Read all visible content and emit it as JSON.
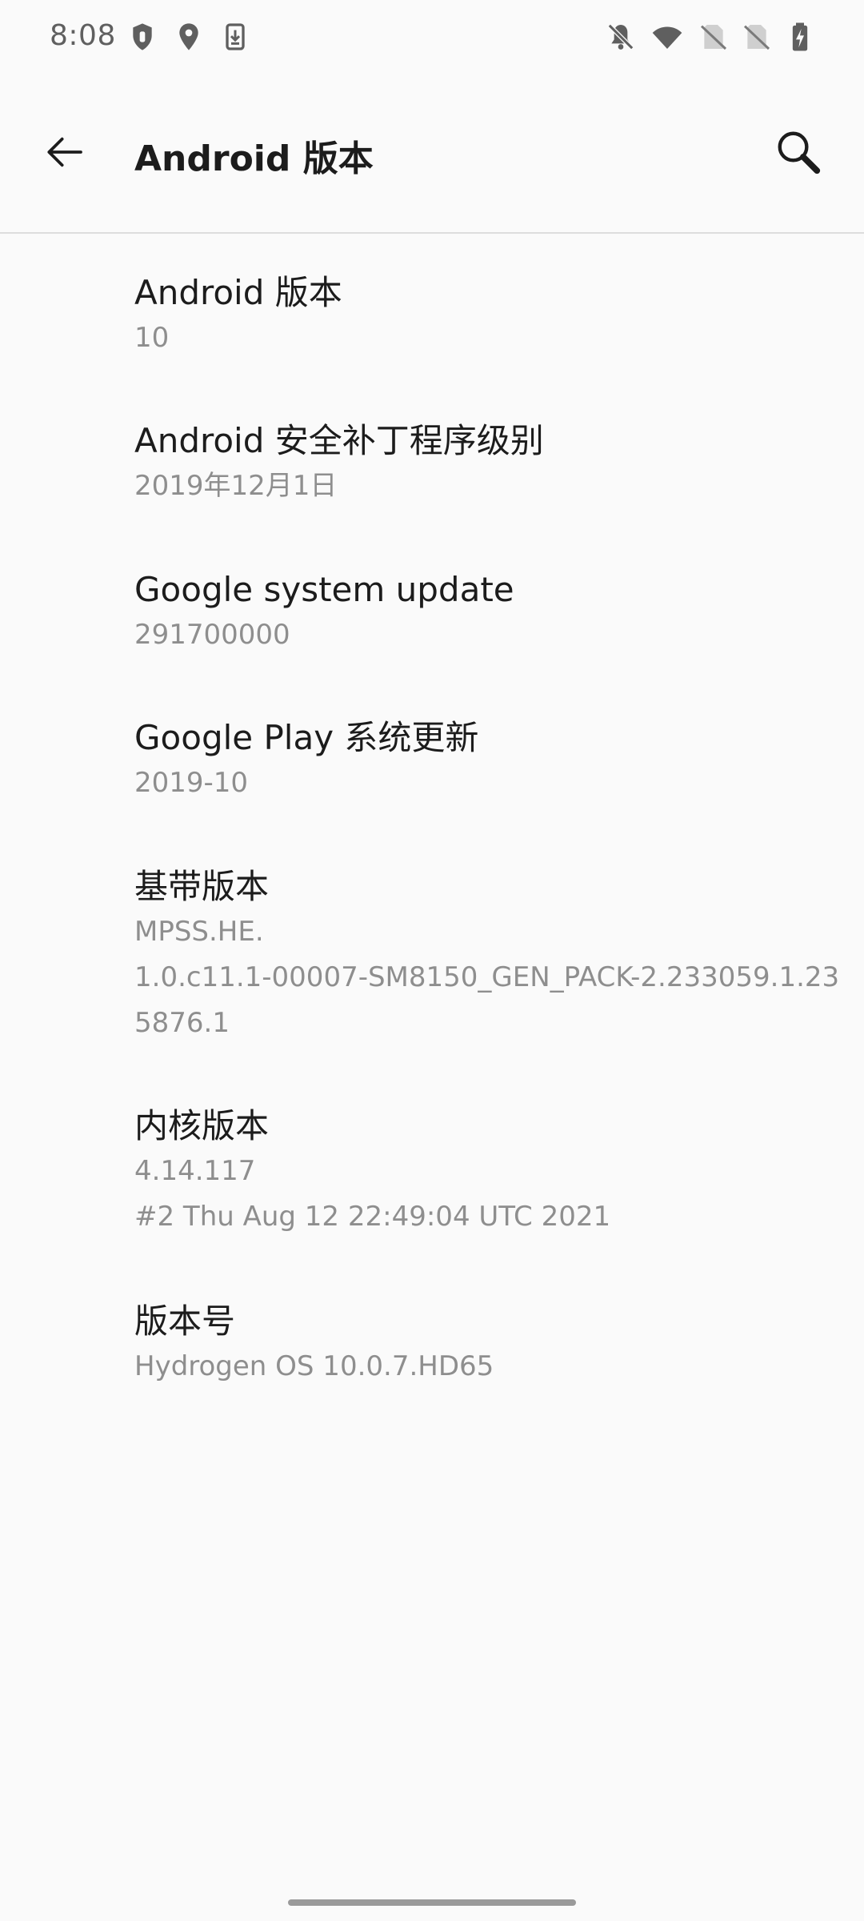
{
  "status_bar": {
    "time": "8:08",
    "left_icons": [
      "shield-notification-icon",
      "location-icon",
      "download-notification-icon"
    ],
    "right_icons": [
      "notifications-off-icon",
      "wifi-icon",
      "no-sim-icon",
      "no-sim-icon",
      "battery-charging-icon"
    ]
  },
  "app_bar": {
    "title": "Android 版本",
    "back_icon": "arrow-back-icon",
    "search_icon": "search-icon"
  },
  "items": [
    {
      "title": "Android 版本",
      "lines": [
        "10"
      ]
    },
    {
      "title": "Android 安全补丁程序级别",
      "lines": [
        "2019年12月1日"
      ]
    },
    {
      "title": "Google system update",
      "lines": [
        "291700000"
      ]
    },
    {
      "title": "Google Play 系统更新",
      "lines": [
        "2019-10"
      ]
    },
    {
      "title": "基带版本",
      "lines": [
        "MPSS.HE.",
        "1.0.c11.1-00007-SM8150_GEN_PACK-2.233059.1.23",
        "5876.1"
      ]
    },
    {
      "title": "内核版本",
      "lines": [
        "4.14.117",
        "#2 Thu Aug 12 22:49:04 UTC 2021"
      ]
    },
    {
      "title": "版本号",
      "lines": [
        "Hydrogen OS 10.0.7.HD65"
      ]
    }
  ],
  "colors": {
    "background": "#fafafa",
    "title_text": "#1c1c1c",
    "secondary_text": "#8e8e8e",
    "divider": "#dddddd"
  }
}
